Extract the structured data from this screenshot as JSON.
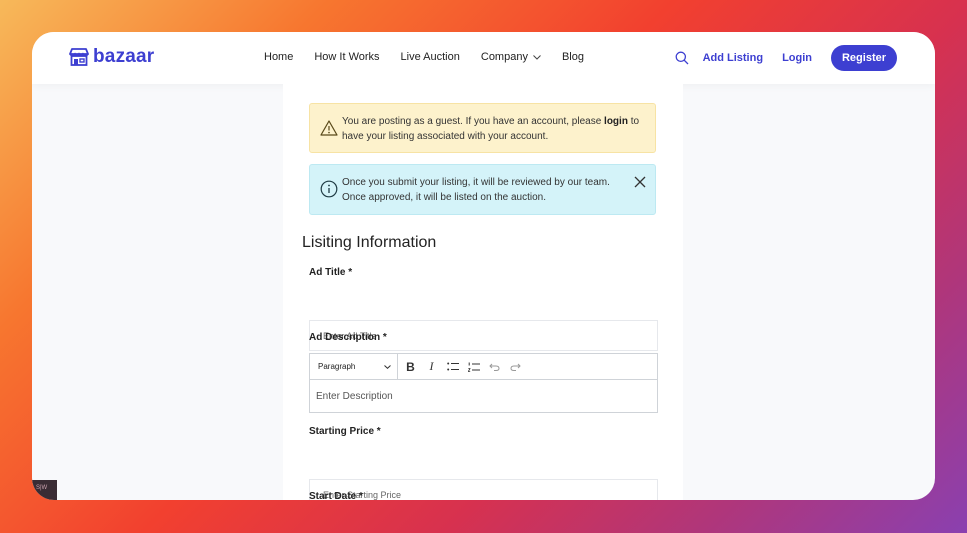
{
  "nav": {
    "logo_text": "bazaar",
    "links": [
      "Home",
      "How It Works",
      "Live Auction",
      "Company",
      "Blog"
    ],
    "add_listing": "Add Listing",
    "login": "Login",
    "register": "Register"
  },
  "alerts": {
    "warning_before": "You are posting as a guest. If you have an account, please ",
    "warning_link": "login",
    "warning_after": " to have your listing associated with your account.",
    "info_text": "Once you submit your listing, it will be reviewed by our team. Once approved, it will be listed on the auction."
  },
  "form": {
    "section_title": "Lisiting Information",
    "ad_title_label": "Ad Title *",
    "ad_title_placeholder": "Enter Ad Title",
    "ad_description_label": "Ad Description *",
    "paragraph_option": "Paragraph",
    "bold_label": "B",
    "italic_label": "I",
    "description_placeholder": "Enter Description",
    "starting_price_label": "Starting Price *",
    "starting_price_placeholder": "Enter Starting Price",
    "start_date_label": "Start Date *"
  },
  "corner_thumb_text": "S|W",
  "colors": {
    "brand": "#3d3fd1",
    "warning_bg": "#fdf2cc",
    "info_bg": "#d4f3f9"
  },
  "icons": [
    "storefront-logo-icon",
    "chevron-down-icon",
    "search-icon",
    "warning-triangle-icon",
    "info-circle-icon",
    "close-icon",
    "bullet-list-icon",
    "numbered-list-icon",
    "undo-icon",
    "redo-icon"
  ]
}
